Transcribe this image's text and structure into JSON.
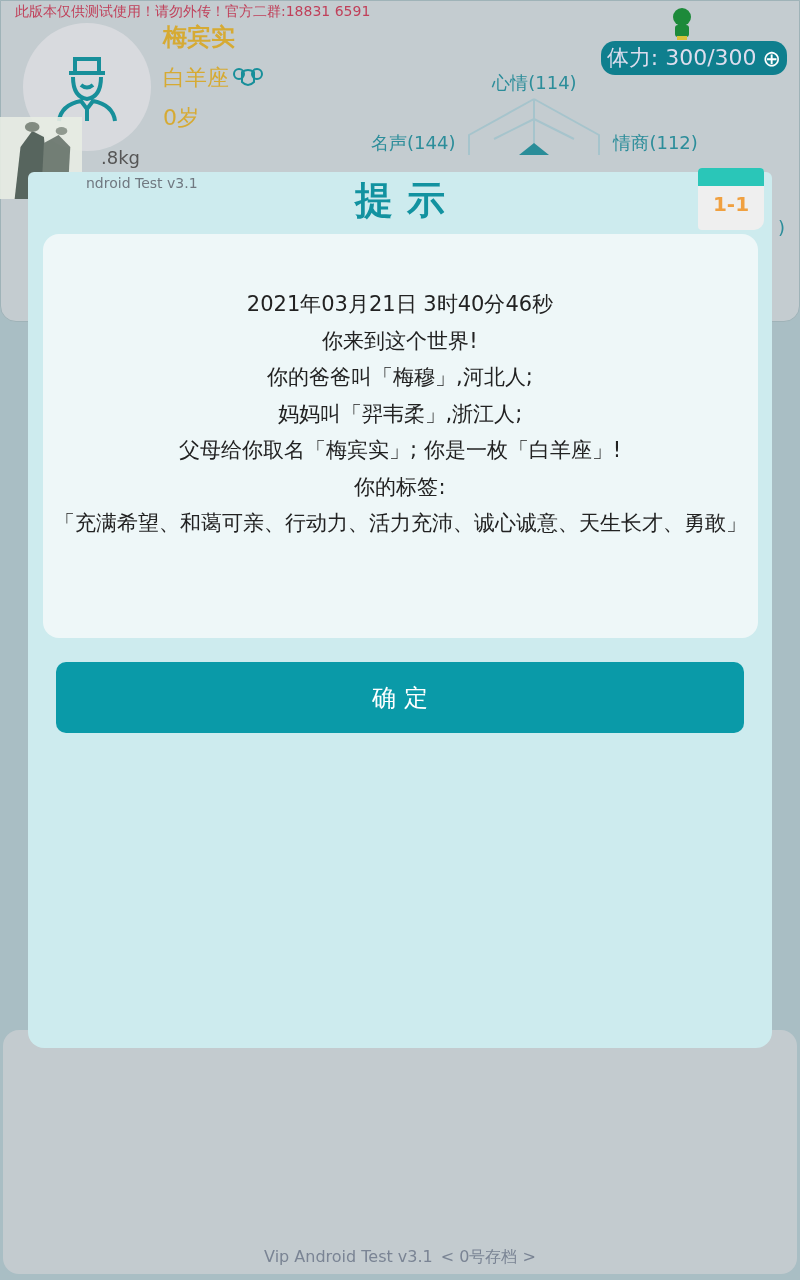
{
  "notice_banner": "此版本仅供测试使用！请勿外传！官方二群:18831 6591",
  "profile": {
    "name": "梅宾实",
    "zodiac": "白羊座",
    "age": "0岁",
    "weight": ".8kg",
    "version_fragment": "ndroid Test v3.1"
  },
  "stamina": {
    "label": "体力: 300/300",
    "button": "⊕"
  },
  "radar_labels": [
    {
      "text": "心情(114)"
    },
    {
      "text": "名声(144)"
    },
    {
      "text": "情商(112)"
    }
  ],
  "radar_cut_label": ")",
  "dialog": {
    "title": "提 示",
    "badge": "1-1",
    "lines": [
      "2021年03月21日 3时40分46秒",
      "你来到这个世界!",
      "你的爸爸叫「梅穆」,河北人;",
      "妈妈叫「羿韦柔」,浙江人;",
      "父母给你取名「梅宾实」; 你是一枚「白羊座」!",
      "你的标签:",
      "「充满希望、和蔼可亲、行动力、活力充沛、诚心诚意、天生长才、勇敢」"
    ],
    "confirm": "确 定"
  },
  "footer": {
    "version": "Vip Android Test v3.1",
    "save_slot": "< 0号存档 >"
  }
}
